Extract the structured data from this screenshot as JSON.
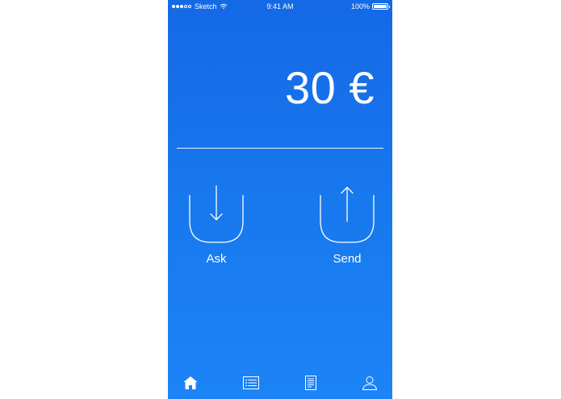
{
  "status_bar": {
    "carrier": "Sketch",
    "time": "9:41 AM",
    "battery": "100%"
  },
  "balance": {
    "amount": "30 €"
  },
  "actions": {
    "ask_label": "Ask",
    "send_label": "Send"
  },
  "tab_bar": {
    "tabs": [
      "home-icon",
      "list-icon",
      "document-icon",
      "profile-icon"
    ],
    "active": "home-icon"
  },
  "colors": {
    "gradient_top": "#1469e6",
    "gradient_bottom": "#1c84f6",
    "foreground": "#ffffff"
  }
}
